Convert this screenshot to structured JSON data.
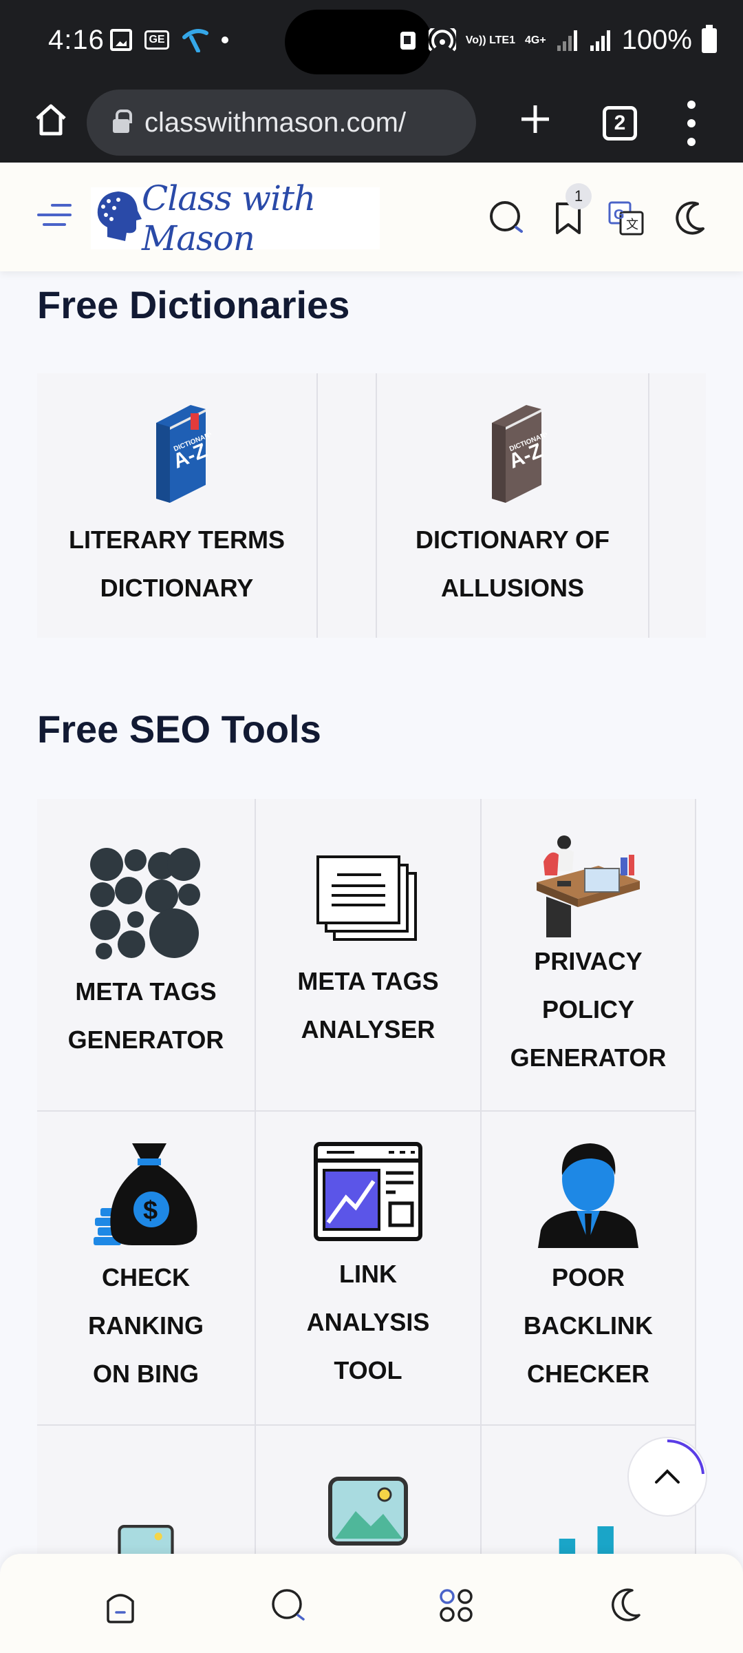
{
  "status_bar": {
    "time": "4:16",
    "network_label": "Vo)) LTE1",
    "data_label": "4G+",
    "battery": "100%"
  },
  "browser": {
    "url": "classwithmason.com/",
    "tab_count": "2"
  },
  "site_header": {
    "logo_text": "Class with Mason",
    "bookmark_badge": "1"
  },
  "dictionaries": {
    "title": "Free Dictionaries",
    "cards": [
      {
        "label_line1": "LITERARY TERMS",
        "label_line2": "DICTIONARY",
        "icon": "dictionary-blue-icon",
        "color": "#1f5fb4"
      },
      {
        "label_line1": "DICTIONARY OF",
        "label_line2": "ALLUSIONS",
        "icon": "dictionary-brown-icon",
        "color": "#6b5a57"
      }
    ]
  },
  "seo_tools": {
    "title": "Free SEO Tools",
    "cards": [
      {
        "lines": [
          "META TAGS",
          "GENERATOR"
        ],
        "icon": "bubbles-icon"
      },
      {
        "lines": [
          "META TAGS",
          "ANALYSER"
        ],
        "icon": "documents-icon"
      },
      {
        "lines": [
          "PRIVACY",
          "POLICY",
          "GENERATOR"
        ],
        "icon": "office-desk-icon"
      },
      {
        "lines": [
          "CHECK",
          "RANKING",
          "ON BING"
        ],
        "icon": "money-bag-icon"
      },
      {
        "lines": [
          "LINK",
          "ANALYSIS",
          "TOOL"
        ],
        "icon": "browser-chart-icon"
      },
      {
        "lines": [
          "POOR",
          "BACKLINK",
          "CHECKER"
        ],
        "icon": "businessman-icon"
      }
    ]
  },
  "colors": {
    "accent": "#4a63c8",
    "title": "#121a33",
    "icon_blue": "#1e88e5"
  }
}
